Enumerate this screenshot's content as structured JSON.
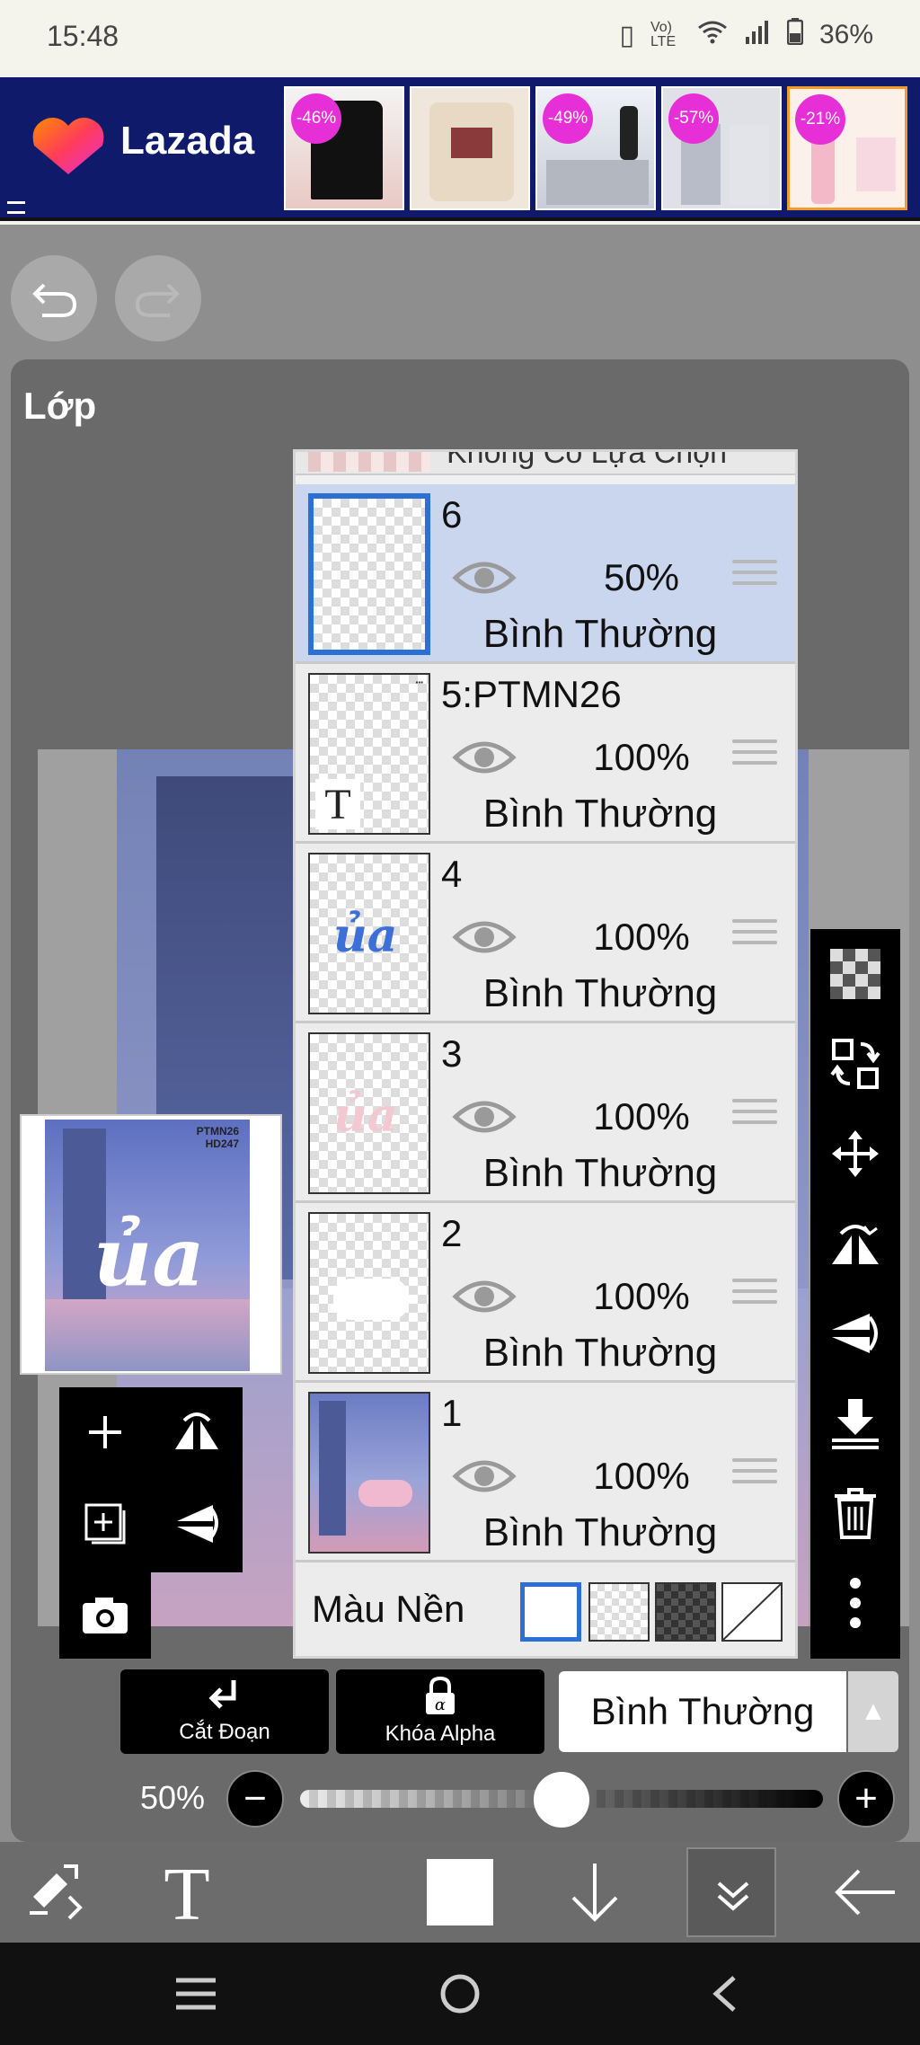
{
  "status_bar": {
    "time": "15:48",
    "battery": "36%",
    "network": "Vo) LTE"
  },
  "ad": {
    "brand": "Lazada",
    "products": [
      {
        "discount": "-46%"
      },
      {
        "discount": ""
      },
      {
        "discount": "-49%"
      },
      {
        "discount": "-57%"
      },
      {
        "discount": "-21%"
      }
    ]
  },
  "panel": {
    "title": "Lớp"
  },
  "preview": {
    "art_text": "ủa",
    "tag_line1": "PTMN26",
    "tag_line2": "HD247"
  },
  "layers": {
    "top_cut_label": "Không Có Lựa Chọn",
    "items": [
      {
        "name": "6",
        "opacity": "50%",
        "blend": "Bình Thường",
        "selected": true
      },
      {
        "name": "5:PTMN26",
        "opacity": "100%",
        "blend": "Bình Thường",
        "thumb_letter": "T"
      },
      {
        "name": "4",
        "opacity": "100%",
        "blend": "Bình Thường",
        "thumb_text": "ủa"
      },
      {
        "name": "3",
        "opacity": "100%",
        "blend": "Bình Thường",
        "thumb_text": "ủa"
      },
      {
        "name": "2",
        "opacity": "100%",
        "blend": "Bình Thường"
      },
      {
        "name": "1",
        "opacity": "100%",
        "blend": "Bình Thường"
      }
    ],
    "background_label": "Màu Nền"
  },
  "controls": {
    "clip_label": "Cắt Đoạn",
    "alpha_lock_label": "Khóa Alpha",
    "blend_mode": "Bình Thường",
    "opacity_label": "50%",
    "opacity_value": 0.5
  },
  "colors": {
    "accent": "#2c6fd5",
    "selected_row": "#c9d6ee",
    "ad_bg": "#0f1a6b",
    "discount": "#e72fd7"
  }
}
